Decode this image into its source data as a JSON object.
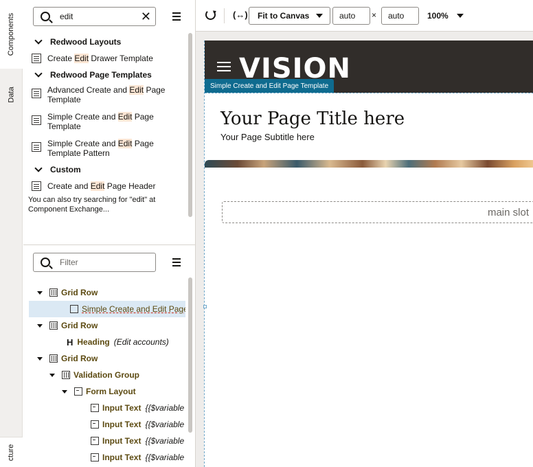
{
  "rail": {
    "components_tab": "Components",
    "data_tab": "Data",
    "structure_tab": "cture"
  },
  "components_panel": {
    "search_value": "edit",
    "groups": [
      {
        "label": "Redwood Layouts",
        "items": [
          {
            "pre": "Create ",
            "hl": "Edit",
            "post": " Drawer Template"
          }
        ]
      },
      {
        "label": "Redwood Page Templates",
        "items": [
          {
            "pre": "Advanced Create and ",
            "hl": "Edit",
            "post": " Page Template"
          },
          {
            "pre": "Simple Create and ",
            "hl": "Edit",
            "post": " Page Template"
          },
          {
            "pre": "Simple Create and ",
            "hl": "Edit",
            "post": " Page Template Pattern"
          }
        ]
      },
      {
        "label": "Custom",
        "items": [
          {
            "pre": "Create and ",
            "hl": "Edit",
            "post": " Page Header"
          }
        ]
      }
    ],
    "note": "You can also try searching for \"edit\" at Component Exchange..."
  },
  "structure_panel": {
    "filter_placeholder": "Filter",
    "tree": [
      {
        "label": "Grid Row",
        "extra": "",
        "icon": "grid-row-icon"
      },
      {
        "label": "Simple Create and Edit Page",
        "extra": "",
        "icon": "template-icon"
      },
      {
        "label": "Grid Row",
        "extra": "",
        "icon": "grid-row-icon"
      },
      {
        "label": "Heading",
        "extra": "(Edit accounts)",
        "icon": "heading-icon"
      },
      {
        "label": "Grid Row",
        "extra": "",
        "icon": "grid-row-icon"
      },
      {
        "label": "Validation Group",
        "extra": "",
        "icon": "validation-group-icon"
      },
      {
        "label": "Form Layout",
        "extra": "",
        "icon": "form-layout-icon"
      },
      {
        "label": "Input Text",
        "extra": "{{$variable",
        "icon": "input-text-icon"
      },
      {
        "label": "Input Text",
        "extra": "{{$variable",
        "icon": "input-text-icon"
      },
      {
        "label": "Input Text",
        "extra": "{{$variable",
        "icon": "input-text-icon"
      },
      {
        "label": "Input Text",
        "extra": "{{$variable",
        "icon": "input-text-icon"
      }
    ]
  },
  "toolbar": {
    "fit_label": "Fit to Canvas",
    "width_value": "auto",
    "height_value": "auto",
    "times": "×",
    "zoom": "100%"
  },
  "canvas": {
    "logo": "VISION",
    "template_tag": "Simple Create and Edit Page Template",
    "page_title": "Your Page Title here",
    "page_subtitle": "Your Page Subtitle here",
    "main_slot": "main slot"
  },
  "colors": {
    "accent": "#2f6f9d",
    "header_bg": "#312d2a",
    "tag_bg": "#0f6b8f",
    "highlight": "#fce6d4",
    "tree_label": "#5c4a11",
    "selected_row": "#dbe9f4"
  }
}
